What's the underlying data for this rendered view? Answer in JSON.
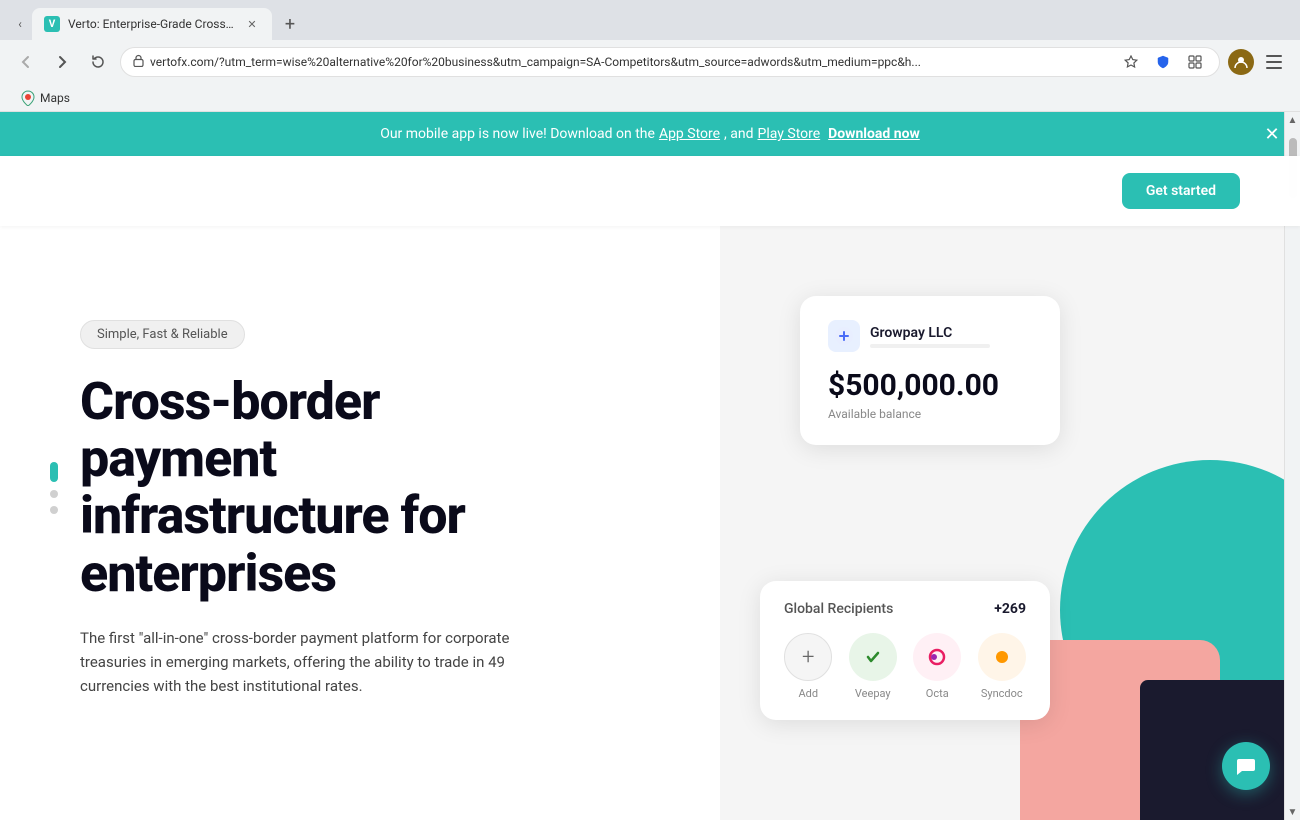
{
  "browser": {
    "tab_title": "Verto: Enterprise-Grade Cross-B",
    "url": "vertofx.com/?utm_term=wise%20alternative%20for%20business&utm_campaign=SA-Competitors&utm_source=adwords&utm_medium=ppc&h...",
    "new_tab_label": "+",
    "back_btn": "←",
    "forward_btn": "→",
    "refresh_btn": "↻",
    "menu_btn": "⋮"
  },
  "bookmarks": [
    {
      "label": "Maps",
      "favicon": "maps"
    }
  ],
  "banner": {
    "text": "Our mobile app is now live! Download on the ",
    "app_store_link": "App Store",
    "separator": ", and ",
    "play_store_link": "Play Store",
    "period": ".",
    "download_now": "Download now"
  },
  "hero": {
    "tag": "Simple, Fast & Reliable",
    "heading_line1": "Cross-border",
    "heading_line2": "payment",
    "heading_line3": "infrastructure for",
    "heading_line4": "enterprises",
    "body_text": "The first \"all-in-one\" cross-border payment platform for corporate treasuries in emerging markets, offering the ability to trade in 49 currencies with the best institutional rates.",
    "nav_cta": "Get started"
  },
  "balance_card": {
    "company_name": "Growpay LLC",
    "amount": "$500,000.00",
    "label": "Available balance"
  },
  "recipients_card": {
    "title": "Global Recipients",
    "count": "+269",
    "items": [
      {
        "name": "Add",
        "type": "add",
        "symbol": "+"
      },
      {
        "name": "Veepay",
        "type": "veepay",
        "symbol": "💚"
      },
      {
        "name": "Octa",
        "type": "octa",
        "symbol": "🌀"
      },
      {
        "name": "Syncdoc",
        "type": "syncdoc",
        "symbol": "🟠"
      }
    ]
  },
  "colors": {
    "teal": "#2bbfb3",
    "pink": "#f4a6a0",
    "dark": "#1a1a2e",
    "bg_gray": "#f5f5f5"
  }
}
